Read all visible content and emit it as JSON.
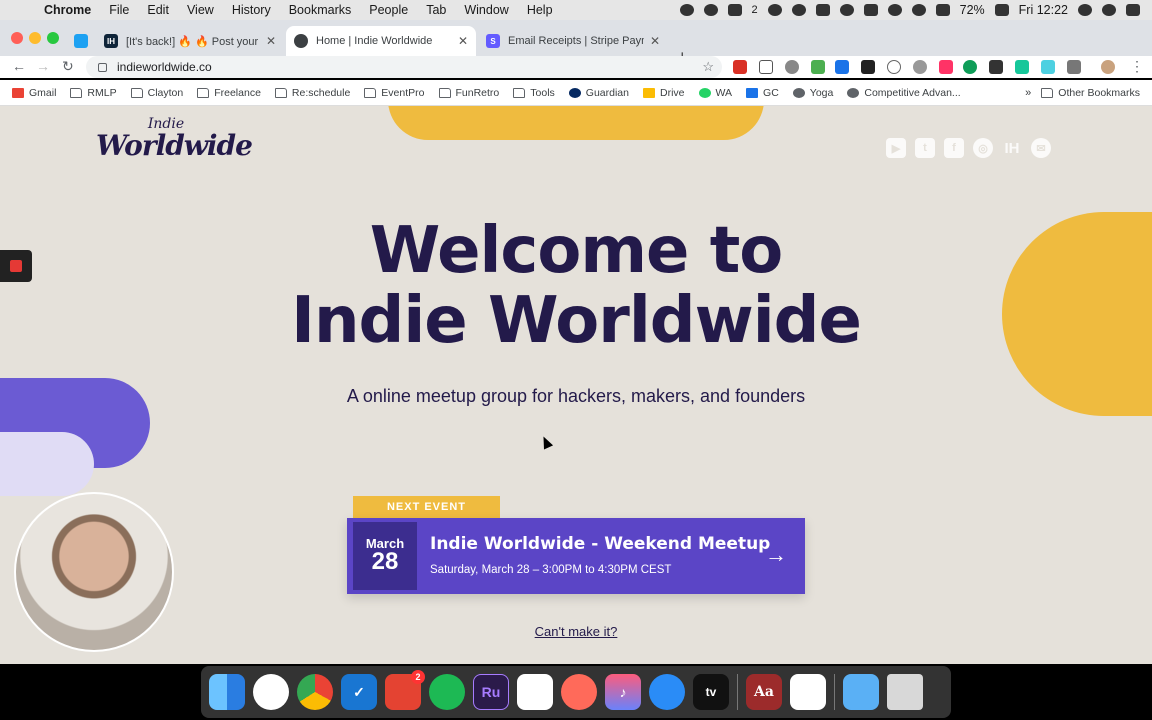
{
  "menubar": {
    "app": "Chrome",
    "items": [
      "File",
      "Edit",
      "View",
      "History",
      "Bookmarks",
      "People",
      "Tab",
      "Window",
      "Help"
    ],
    "battery": "72%",
    "clock": "Fri 12:22",
    "badge_count": "2"
  },
  "tabs": [
    {
      "title": "[It's back!] 🔥 🔥 Post your SAAS",
      "active": false
    },
    {
      "title": "Home | Indie Worldwide",
      "active": true
    },
    {
      "title": "Email Receipts | Stripe Payments",
      "active": false
    }
  ],
  "omnibox": {
    "url": "indieworldwide.co"
  },
  "bookmarks": {
    "items": [
      "Gmail",
      "RMLP",
      "Clayton",
      "Freelance",
      "Re:schedule",
      "EventPro",
      "FunRetro",
      "Tools",
      "Guardian",
      "Drive",
      "WA",
      "GC",
      "Yoga",
      "Competitive Advan..."
    ],
    "more": "»",
    "other": "Other Bookmarks"
  },
  "page": {
    "logo_small": "Indie",
    "logo_big": "Worldwide",
    "social": [
      "youtube-icon",
      "twitter-icon",
      "facebook-icon",
      "dribbble-icon",
      "indiehackers-icon",
      "email-icon"
    ],
    "headline_line1": "Welcome to",
    "headline_line2": "Indie Worldwide",
    "tagline": "A online meetup group for hackers, makers, and founders",
    "next_event_label": "NEXT EVENT",
    "event": {
      "month": "March",
      "day": "28",
      "title": "Indie Worldwide - Weekend Meetup",
      "when": "Saturday, March 28 – 3:00PM to 4:30PM CEST",
      "arrow": "→"
    },
    "cant_make_it": "Can't make it?",
    "colors": {
      "yellow": "#efbb3f",
      "purple": "#5b45c6",
      "navy": "#231a4a",
      "background": "#e5e1da"
    }
  },
  "dock": {
    "apps": [
      "Finder",
      "Photos",
      "Chrome",
      "Things",
      "Todoist",
      "Spotify",
      "Ru",
      "Slack",
      "Affinity",
      "Music",
      "Messages",
      "TV",
      "Dictionary",
      "Numbers",
      "Downloads",
      "Trash"
    ],
    "todoist_badge": "2",
    "ru_label": "Ru",
    "tv_label": "tv",
    "dictionary_label": "Aa"
  }
}
